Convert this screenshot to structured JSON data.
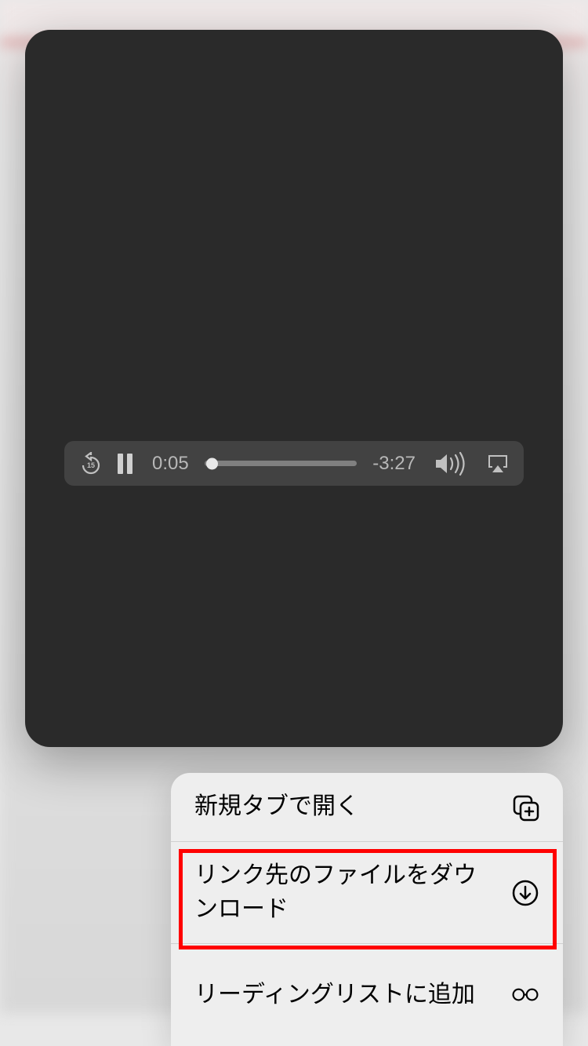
{
  "player": {
    "elapsed": "0:05",
    "remaining": "-3:27",
    "rewind_seconds": "15"
  },
  "menu": {
    "items": [
      {
        "label": "新規タブで開く",
        "icon": "duplicate-tab"
      },
      {
        "label": "リンク先のファイルをダウンロード",
        "icon": "download"
      },
      {
        "label": "リーディングリストに追加",
        "icon": "glasses"
      }
    ]
  }
}
